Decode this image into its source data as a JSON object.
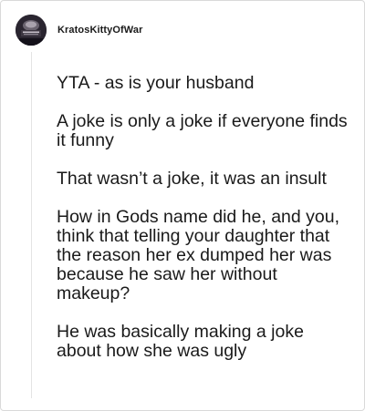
{
  "comment": {
    "author": "KratosKittyOfWar",
    "paragraphs": [
      "YTA - as is your husband",
      "A joke is only a joke if everyone finds it funny",
      "That wasn’t a joke, it was an insult",
      "How in Gods name did he, and you, think that telling your daughter that the reason her ex dumped her was because he saw her without makeup?",
      "He was basically making a joke about how she was ugly"
    ]
  }
}
